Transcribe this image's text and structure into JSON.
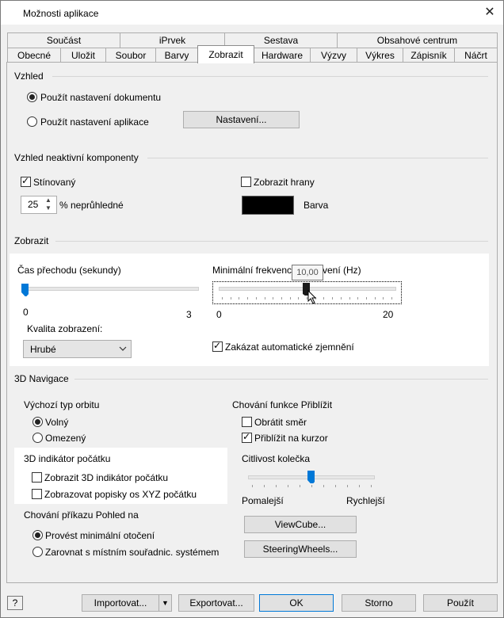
{
  "window": {
    "title": "Možnosti aplikace"
  },
  "tabs_row1": [
    "Součást",
    "iPrvek",
    "Sestava",
    "Obsahové centrum"
  ],
  "tabs_row2": [
    "Obecné",
    "Uložit",
    "Soubor",
    "Barvy",
    "Zobrazit",
    "Hardware",
    "Výzvy",
    "Výkres",
    "Zápisník",
    "Náčrt"
  ],
  "active_tab": "Zobrazit",
  "vzhled": {
    "label": "Vzhled",
    "option_document": "Použít nastavení dokumentu",
    "option_app": "Použít nastavení aplikace",
    "settings_button": "Nastavení..."
  },
  "inactive": {
    "label": "Vzhled neaktivní komponenty",
    "shaded_label": "Stínovaný",
    "opacity_value": "25",
    "opacity_label": "% neprůhledné",
    "show_edges_label": "Zobrazit hrany",
    "color_label": "Barva",
    "color_value": "#000000"
  },
  "display": {
    "label": "Zobrazit",
    "transition_label": "Čas přechodu (sekundy)",
    "transition_min": "0",
    "transition_max": "3",
    "transition_value": 0,
    "frame_label_start": "Minimální frekvenc",
    "frame_label_end": "vení (Hz)",
    "frame_min": "0",
    "frame_max": "20",
    "frame_value": 10,
    "frame_tooltip": "10,00",
    "quality_label": "Kvalita zobrazení:",
    "quality_value": "Hrubé",
    "disable_downgrade_label": "Zakázat automatické zjemnění"
  },
  "nav3d": {
    "label": "3D Navigace",
    "orbit_label": "Výchozí typ orbitu",
    "orbit_free": "Volný",
    "orbit_constrained": "Omezený",
    "indicator_label": "3D indikátor počátku",
    "show_indicator": "Zobrazit 3D indikátor počátku",
    "show_axis_labels": "Zobrazovat popisky os XYZ počátku",
    "view_cmd_label": "Chování příkazu Pohled na",
    "min_rotation": "Provést minimální otočení",
    "align_ucs": "Zarovnat s místním souřadnic. systémem",
    "zoom_label": "Chování funkce Přiblížit",
    "reverse_dir": "Obrátit směr",
    "zoom_cursor": "Přiblížit na kurzor",
    "wheel_label": "Citlivost kolečka",
    "wheel_slow": "Pomalejší",
    "wheel_fast": "Rychlejší",
    "wheel_value": 0.5,
    "viewcube_button": "ViewCube...",
    "steering_button": "SteeringWheels..."
  },
  "footer": {
    "help_icon": "?",
    "import_button": "Importovat...",
    "export_button": "Exportovat...",
    "ok_button": "OK",
    "cancel_button": "Storno",
    "apply_button": "Použít"
  }
}
